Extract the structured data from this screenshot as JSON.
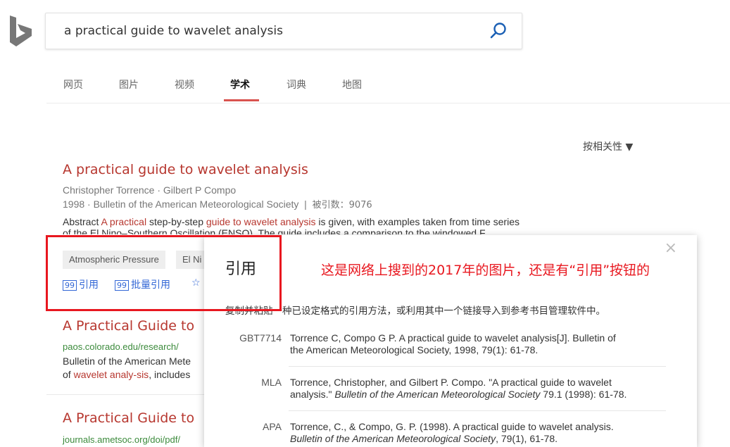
{
  "search": {
    "query": "a practical guide to wavelet analysis"
  },
  "tabs": [
    {
      "label": "网页"
    },
    {
      "label": "图片"
    },
    {
      "label": "视频"
    },
    {
      "label": "学术"
    },
    {
      "label": "词典"
    },
    {
      "label": "地图"
    }
  ],
  "sort_label": "按相关性 ▼",
  "result1": {
    "title": "A practical guide to wavelet analysis",
    "authors": "Christopher Torrence · Gilbert P Compo",
    "journal": "1998 · Bulletin of the American Meteorological Society",
    "citations": "被引数：9076",
    "abstract_prefix": "Abstract ",
    "abstract_hl1": "A practical",
    "abstract_mid": " step-by-step ",
    "abstract_hl2": "guide to wavelet analysis",
    "abstract_suffix": " is given, with examples taken from time series",
    "abstract_line2": "of the El Nino–Southern Oscillation (ENSO). The guide includes a comparison to the windowed F",
    "tags": [
      "Atmospheric Pressure",
      "El Ni"
    ],
    "actions": {
      "cite": "引用",
      "batch_cite": "批量引用"
    }
  },
  "result2": {
    "title": "A Practical Guide to",
    "url": "paos.colorado.edu/research/",
    "desc1": "Bulletin of the American Mete",
    "desc2_prefix": "of ",
    "desc2_hl": "wavelet analy-sis",
    "desc2_suffix": ", includes"
  },
  "result3": {
    "title": "A Practical Guide to",
    "url": "journals.ametsoc.org/doi/pdf/"
  },
  "modal": {
    "title": "引用",
    "close": "×",
    "description": "复制并粘贴一种已设定格式的引用方法，或利用其中一个链接导入到参考书目管理软件中。",
    "citations": [
      {
        "format": "GBT7714",
        "line1": "Torrence C, Compo G P. A practical guide to wavelet analysis[J]. Bulletin of",
        "line2": "the American Meteorological Society, 1998, 79(1): 61-78."
      },
      {
        "format": "MLA",
        "line1": "Torrence, Christopher, and Gilbert P. Compo. \"A practical guide to wavelet",
        "line2_a": "analysis.\" ",
        "line2_i": "Bulletin of the American Meteorological Society",
        "line2_b": " 79.1 (1998): 61-78."
      },
      {
        "format": "APA",
        "line1": "Torrence, C., & Compo, G. P. (1998). A practical guide to wavelet analysis.",
        "line2_i": "Bulletin of the American Meteorological Society",
        "line2_b": ", 79(1), 61-78."
      }
    ]
  },
  "annotation": {
    "note": "这是网络上搜到的2017年的图片，还是有“引用”按钮的",
    "color": "#e8171f"
  },
  "colors": {
    "title_red": "#b7372f",
    "link_blue": "#3367d6",
    "url_green": "#3b8a3b",
    "tab_underline": "#d9534f"
  }
}
